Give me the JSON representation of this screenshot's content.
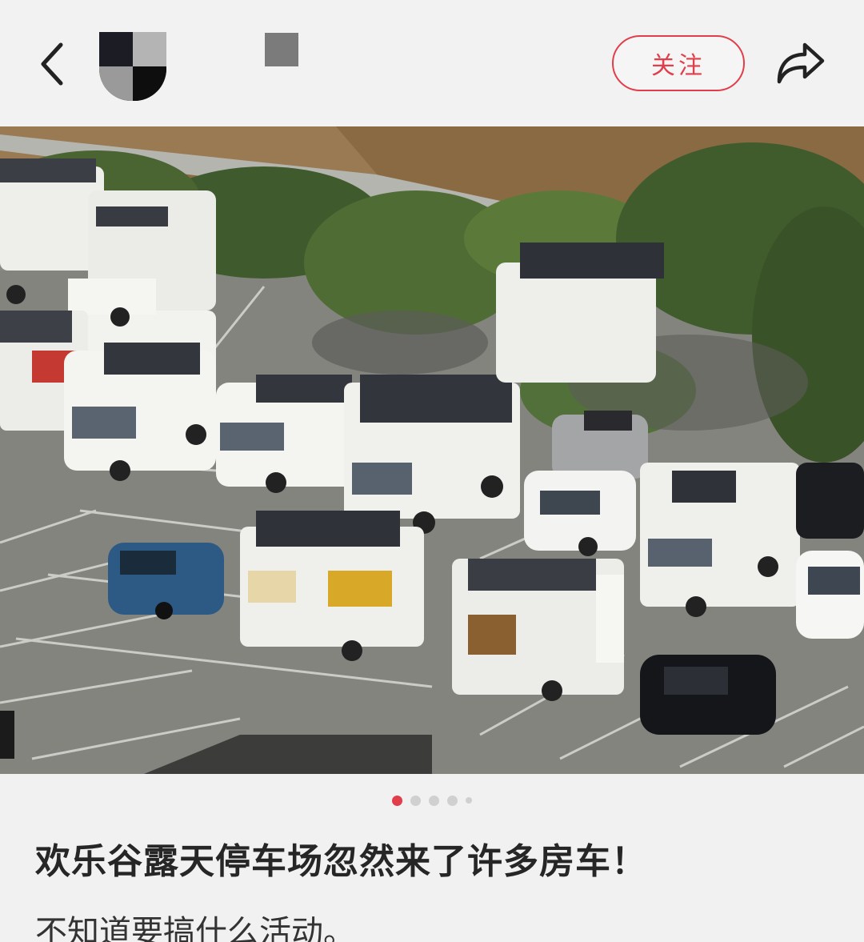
{
  "header": {
    "follow_label": "关注",
    "back_icon": "chevron-left-icon",
    "share_icon": "share-arrow-icon",
    "accent_color": "#e23d4a"
  },
  "carousel": {
    "image_alt": "parking-lot-photo",
    "page_count": 5,
    "active_index": 0
  },
  "post": {
    "title": "欢乐谷露天停车场忽然来了许多房车！",
    "body": "不知道要搞什么活动。"
  }
}
